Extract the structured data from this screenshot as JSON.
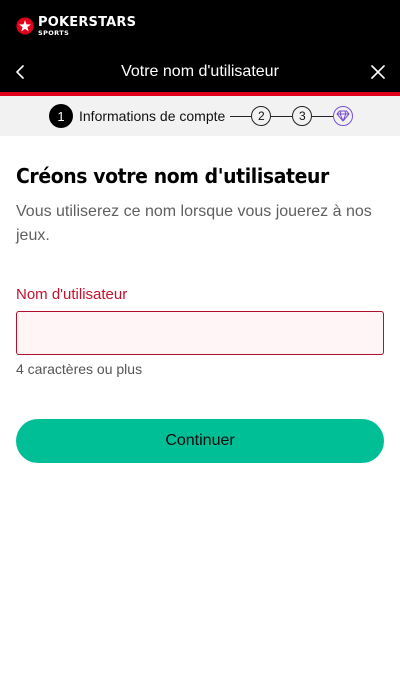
{
  "brand": {
    "name": "POKERSTARS",
    "sub": "SPORTS",
    "accent": "#e2001a"
  },
  "header": {
    "title": "Votre nom d'utilisateur",
    "back_icon": "chevron-left-icon",
    "close_icon": "close-icon"
  },
  "stepper": {
    "active_step": "1",
    "active_label": "Informations de compte",
    "steps": [
      "2",
      "3"
    ],
    "final_icon": "diamond-icon",
    "final_color": "#7b4fd6"
  },
  "main": {
    "heading": "Créons votre nom d'utilisateur",
    "description": "Vous utiliserez ce nom lorsque vous jouerez à nos jeux.",
    "field_label": "Nom d'utilisateur",
    "field_value": "",
    "field_hint": "4 caractères ou plus",
    "button_label": "Continuer",
    "button_color": "#00bf97"
  }
}
